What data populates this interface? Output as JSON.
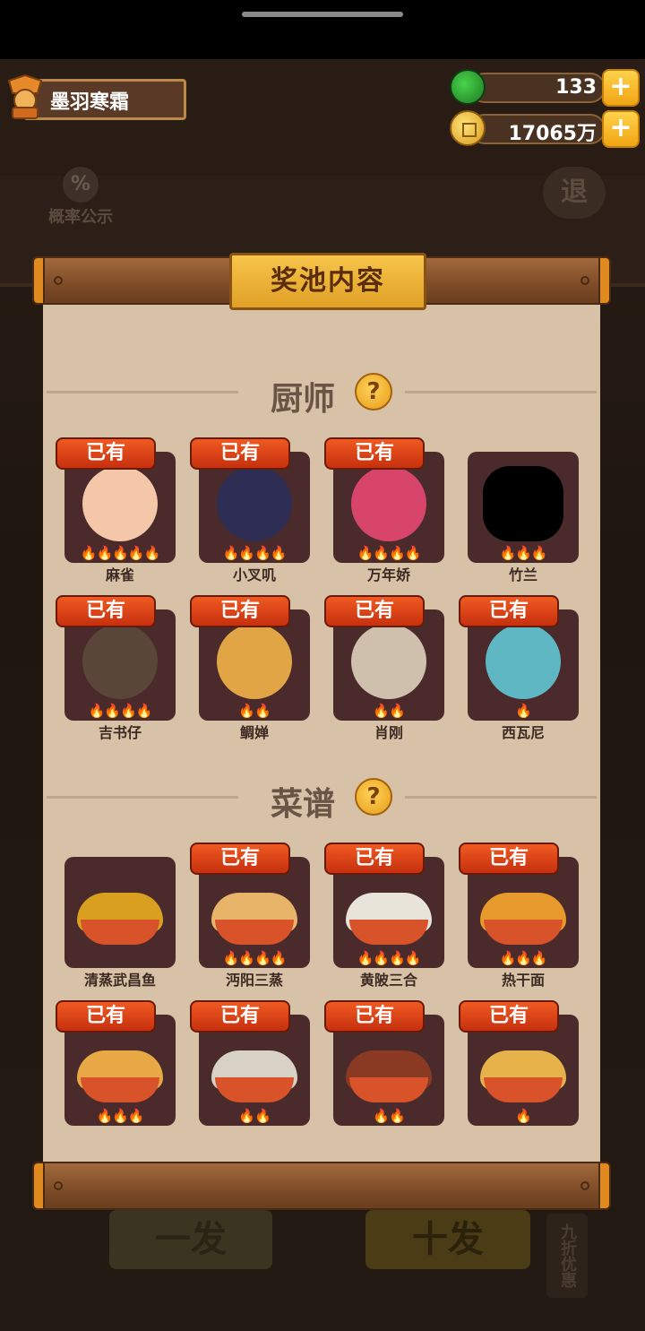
{
  "player": {
    "name": "墨羽寒霜"
  },
  "resources": {
    "gems": {
      "value": "133",
      "color": "#2ea93a"
    },
    "coins": {
      "value": "17065万",
      "color": "#e3ae2c"
    }
  },
  "background": {
    "probability_label": "概率公示",
    "exit_label": "退",
    "draw_one_label": "一发",
    "draw_ten_label": "十发",
    "discount_label": "九折优惠"
  },
  "panel": {
    "title": "奖池内容",
    "owned_label": "已有",
    "chef_section": {
      "title": "厨师",
      "help": "?"
    },
    "recipe_section": {
      "title": "菜谱",
      "help": "?"
    },
    "chefs": [
      {
        "name": "麻雀",
        "owned": true,
        "stars": 5,
        "color": "#f3c7a8"
      },
      {
        "name": "小叉叽",
        "owned": true,
        "stars": 4,
        "color": "#2e2e55"
      },
      {
        "name": "万年娇",
        "owned": true,
        "stars": 4,
        "color": "#d8456a"
      },
      {
        "name": "竹兰",
        "owned": false,
        "stars": 3,
        "color": "#000000"
      },
      {
        "name": "吉书仔",
        "owned": true,
        "stars": 4,
        "color": "#5a4638"
      },
      {
        "name": "鲷婵",
        "owned": true,
        "stars": 2,
        "color": "#e2a545"
      },
      {
        "name": "肖刚",
        "owned": true,
        "stars": 2,
        "color": "#cfc0ad"
      },
      {
        "name": "西瓦尼",
        "owned": true,
        "stars": 1,
        "color": "#5fb7c4"
      }
    ],
    "recipes": [
      {
        "name": "清蒸武昌鱼",
        "owned": false,
        "stars": 0,
        "color": "#d9a020"
      },
      {
        "name": "沔阳三蒸",
        "owned": true,
        "stars": 4,
        "color": "#e7b46a"
      },
      {
        "name": "黄陂三合",
        "owned": true,
        "stars": 4,
        "color": "#e9e4da"
      },
      {
        "name": "热干面",
        "owned": true,
        "stars": 3,
        "color": "#e99a2c"
      },
      {
        "name": "",
        "owned": true,
        "stars": 3,
        "color": "#e8a845"
      },
      {
        "name": "",
        "owned": true,
        "stars": 2,
        "color": "#d8d2c4"
      },
      {
        "name": "",
        "owned": true,
        "stars": 2,
        "color": "#8a3a22"
      },
      {
        "name": "",
        "owned": true,
        "stars": 1,
        "color": "#e5b34a"
      }
    ]
  }
}
